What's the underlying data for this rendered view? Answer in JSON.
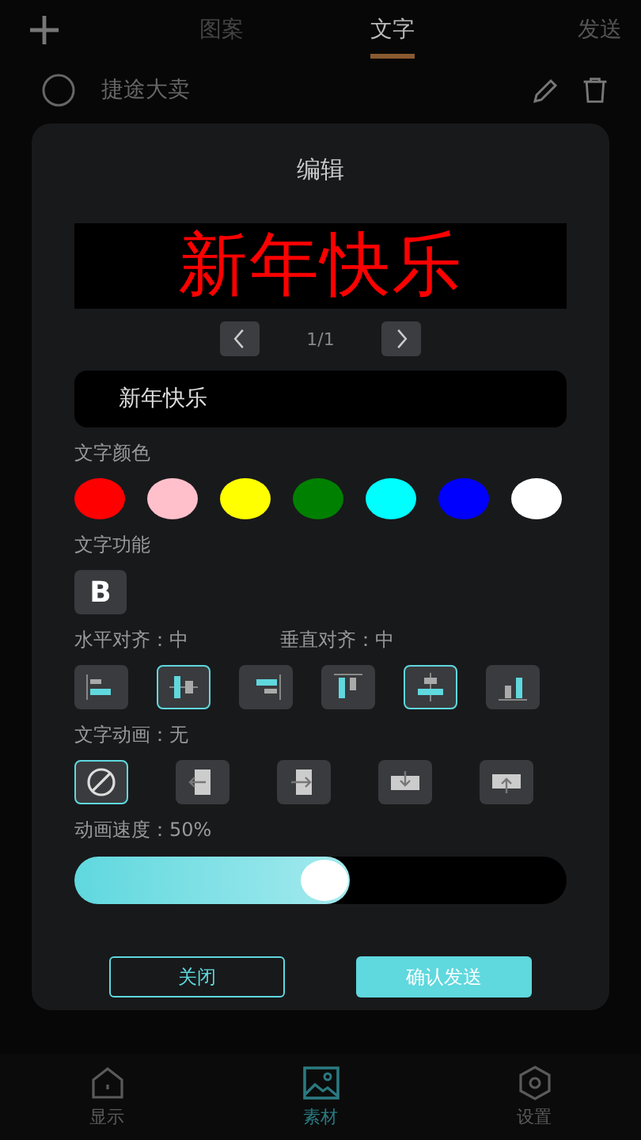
{
  "top_bar": {
    "tabs": [
      {
        "label": "图案",
        "selected": false
      },
      {
        "label": "文字",
        "selected": true
      }
    ],
    "action": "发送"
  },
  "list_item": {
    "name": "捷途大卖"
  },
  "dialog": {
    "title": "编辑",
    "preview_text": "新年快乐",
    "pager": "1/1",
    "text_value": "新年快乐",
    "color_label": "文字颜色",
    "colors": [
      {
        "color": "#ff0000"
      },
      {
        "color": "#ffc0cb"
      },
      {
        "color": "#ffff00"
      },
      {
        "color": "#008000"
      },
      {
        "color": "#00ffff"
      },
      {
        "color": "#0000ff"
      },
      {
        "color": "#ffffff"
      }
    ],
    "feature_label": "文字功能",
    "bold": {
      "label": "B",
      "selected": false
    },
    "h_align_label": "水平对齐：中",
    "v_align_label": "垂直对齐：中",
    "align_buttons": [
      {
        "kind": "left",
        "selected": false
      },
      {
        "kind": "hcenter",
        "selected": true
      },
      {
        "kind": "right",
        "selected": false
      },
      {
        "kind": "top",
        "selected": false
      },
      {
        "kind": "vcenter",
        "selected": true
      },
      {
        "kind": "bottom",
        "selected": false
      }
    ],
    "animation_label": "文字动画：无",
    "animations": [
      {
        "kind": "none",
        "selected": true
      },
      {
        "kind": "left",
        "selected": false
      },
      {
        "kind": "right",
        "selected": false
      },
      {
        "kind": "down",
        "selected": false
      },
      {
        "kind": "up",
        "selected": false
      }
    ],
    "speed_label": "动画速度：50%",
    "speed": {
      "level": 0.56
    },
    "cancel": "关闭",
    "confirm": "确认发送"
  },
  "bottom_nav": [
    {
      "kind": "home",
      "label": "显示",
      "selected": false
    },
    {
      "kind": "image",
      "label": "素材",
      "selected": true
    },
    {
      "kind": "settings",
      "label": "设置",
      "selected": false
    }
  ]
}
